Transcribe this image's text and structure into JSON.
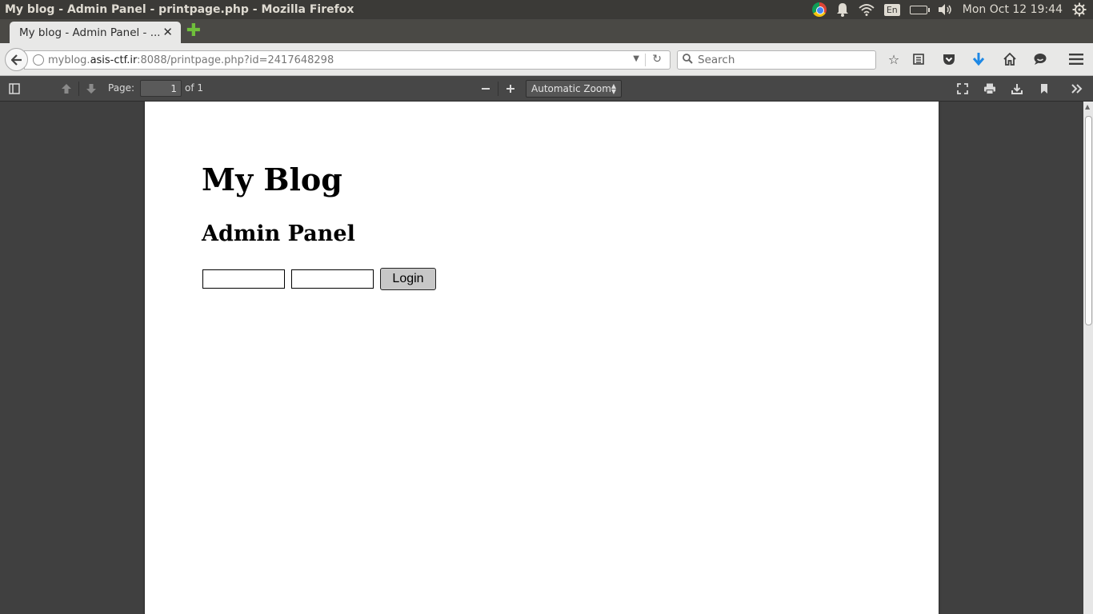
{
  "window": {
    "title": "My blog - Admin Panel - printpage.php - Mozilla Firefox"
  },
  "tray": {
    "language": "En",
    "clock": "Mon Oct 12 19:44"
  },
  "tabs": [
    {
      "label": "My blog - Admin Panel - ..."
    }
  ],
  "navbar": {
    "url_prefix": "myblog.",
    "url_domain": "asis-ctf.ir",
    "url_suffix": ":8088/printpage.php?id=2417648298",
    "search_placeholder": "Search"
  },
  "pdf_toolbar": {
    "page_label": "Page:",
    "page_value": "1",
    "page_total": "of 1",
    "zoom": "Automatic Zoom"
  },
  "document": {
    "heading": "My Blog",
    "subheading": "Admin Panel",
    "login_label": "Login"
  },
  "colors": {
    "panel": "#3b3a37",
    "toolbar": "#474747",
    "viewport": "#404040",
    "download_arrow": "#1e88e5",
    "new_tab_plus": "#6fbf3b"
  }
}
